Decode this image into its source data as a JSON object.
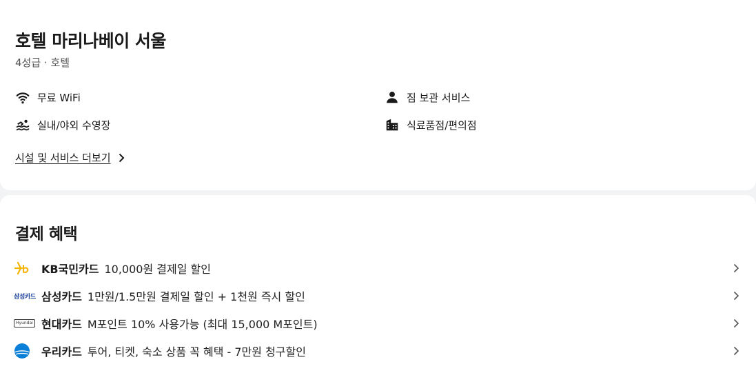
{
  "hotel": {
    "name": "호텔 마리나베이 서울",
    "subtitle": "4성급 · 호텔"
  },
  "amenities": [
    {
      "icon": "wifi-icon",
      "label": "무료 WiFi"
    },
    {
      "icon": "person-icon",
      "label": "짐 보관 서비스"
    },
    {
      "icon": "swimming-icon",
      "label": "실내/야외 수영장"
    },
    {
      "icon": "building-icon",
      "label": "식료품점/편의점"
    }
  ],
  "more_link": "시설 및 서비스 더보기",
  "payment": {
    "title": "결제 혜택",
    "benefits": [
      {
        "logo": "kb-logo",
        "card": "KB국민카드",
        "desc": "10,000원 결제일 할인"
      },
      {
        "logo": "samsung-logo",
        "logo_text": "삼성카드",
        "card": "삼성카드",
        "desc": "1만원/1.5만원 결제일 할인 + 1천원 즉시 할인"
      },
      {
        "logo": "hyundai-logo",
        "logo_text": "Hyundai",
        "card": "현대카드",
        "desc": "M포인트 10% 사용가능 (최대 15,000 M포인트)"
      },
      {
        "logo": "woori-logo",
        "card": "우리카드",
        "desc": "투어, 티켓, 숙소 상품 꼭 혜택 - 7만원 청구할인"
      }
    ]
  },
  "colors": {
    "kb": "#f5b400",
    "samsung": "#1b3fa0",
    "woori": "#0a7fd8"
  }
}
